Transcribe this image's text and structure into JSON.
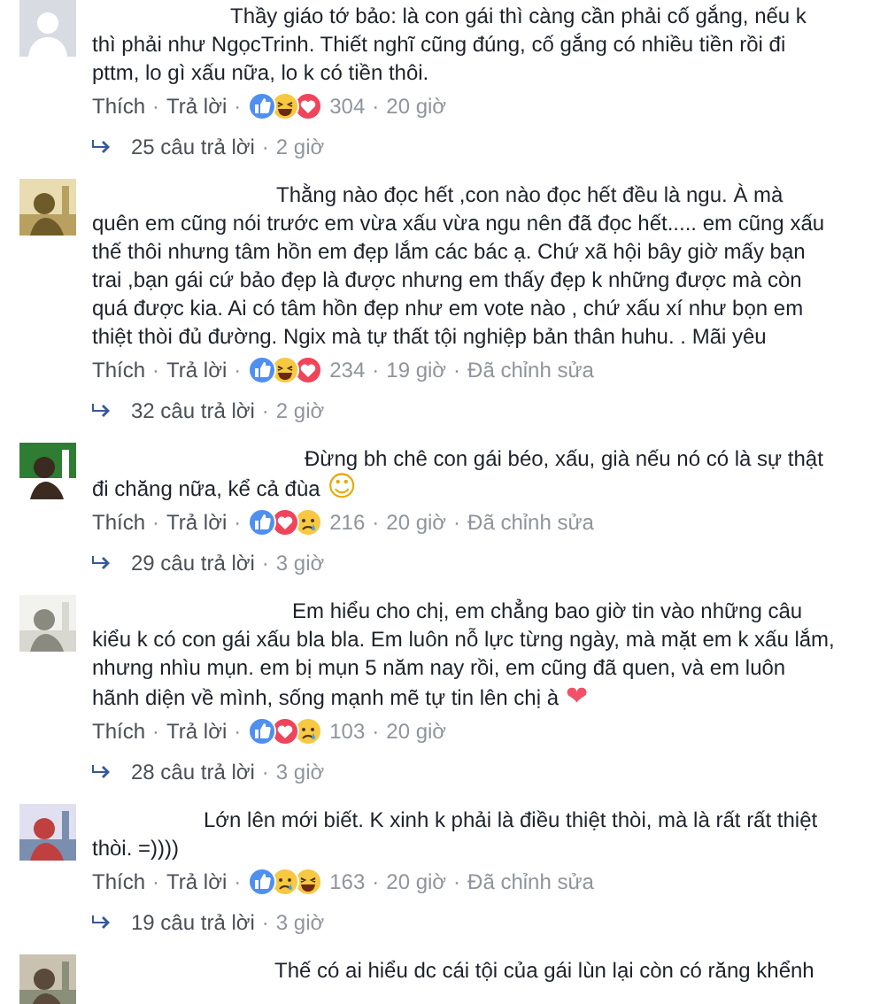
{
  "comments": [
    {
      "avatar": {
        "kind": "default"
      },
      "text": "Thầy giáo tớ bảo: là con gái thì càng cần phải cố gắng, nếu k thì phải như NgọcTrinh. Thiết nghĩ cũng đúng, cố gắng có nhiều tiền rồi đi pttm, lo gì xấu nữa, lo k có tiền thôi.",
      "like": "Thích",
      "reply": "Trả lời",
      "reactions": [
        {
          "kind": "like"
        },
        {
          "kind": "haha"
        },
        {
          "kind": "love"
        }
      ],
      "count": "304",
      "time": "20 giờ",
      "separators": [
        "·",
        "·",
        "·"
      ],
      "replies_separator": "·",
      "replies": "25 câu trả lời",
      "replies_time": "2 giờ"
    },
    {
      "avatar": {
        "kind": "picture"
      },
      "text": "Thằng nào đọc hết ,con nào đọc hết đều là ngu. À mà quên em cũng nói trước em vừa xấu vừa ngu nên đã đọc hết..... em cũng xấu thế thôi nhưng tâm hồn em đẹp lắm các bác ạ. Chứ xã hội bây giờ mấy bạn trai ,bạn gái cứ bảo đẹp là được nhưng em thấy đẹp k những được mà còn quá được kia. Ai có tâm hồn đẹp như em vote nào , chứ xấu xí như bọn em thiệt thòi đủ đường. Ngix mà tự thất tội nghiệp bản thân huhu. . Mãi yêu",
      "like": "Thích",
      "reply": "Trả lời",
      "reactions": [
        {
          "kind": "like"
        },
        {
          "kind": "haha"
        },
        {
          "kind": "love"
        }
      ],
      "count": "234",
      "time": "19 giờ",
      "edited": "Đã chỉnh sửa",
      "separators": [
        "·",
        "·",
        "·",
        "·"
      ],
      "replies_separator": "·",
      "replies": "32 câu trả lời",
      "replies_time": "2 giờ"
    },
    {
      "avatar": {
        "kind": "picture"
      },
      "text": "Đừng bh chê con gái béo, xấu, già nếu nó có là sự thật đi chăng nữa, kể cả đùa",
      "emoji": {
        "kind": "smile",
        "char": "☺"
      },
      "like": "Thích",
      "reply": "Trả lời",
      "reactions": [
        {
          "kind": "like"
        },
        {
          "kind": "love"
        },
        {
          "kind": "sad"
        }
      ],
      "count": "216",
      "time": "20 giờ",
      "edited": "Đã chỉnh sửa",
      "separators": [
        "·",
        "·",
        "·",
        "·"
      ],
      "replies_separator": "·",
      "replies": "29 câu trả lời",
      "replies_time": "3 giờ"
    },
    {
      "avatar": {
        "kind": "picture"
      },
      "text": "Em hiểu cho chị, em chẳng bao giờ tin vào những câu kiểu k có con gái xấu bla bla. Em luôn nỗ lực từng ngày, mà mặt em k xấu lắm, nhưng nhìu mụn. em bị mụn 5 năm nay rồi, em cũng đã quen, và em luôn hãnh diện về mình, sống mạnh mẽ tự tin lên chị à",
      "emoji": {
        "kind": "heart",
        "char": "❤"
      },
      "like": "Thích",
      "reply": "Trả lời",
      "reactions": [
        {
          "kind": "like"
        },
        {
          "kind": "love"
        },
        {
          "kind": "sad"
        }
      ],
      "count": "103",
      "time": "20 giờ",
      "separators": [
        "·",
        "·",
        "·"
      ],
      "replies_separator": "·",
      "replies": "28 câu trả lời",
      "replies_time": "3 giờ"
    },
    {
      "avatar": {
        "kind": "picture"
      },
      "text": "Lớn lên mới biết. K xinh k phải là điều thiệt thòi, mà là rất rất thiệt thòi. =))))",
      "like": "Thích",
      "reply": "Trả lời",
      "reactions": [
        {
          "kind": "like"
        },
        {
          "kind": "sad"
        },
        {
          "kind": "haha"
        }
      ],
      "count": "163",
      "time": "20 giờ",
      "edited": "Đã chỉnh sửa",
      "separators": [
        "·",
        "·",
        "·",
        "·"
      ],
      "replies_separator": "·",
      "replies": "19 câu trả lời",
      "replies_time": "3 giờ"
    },
    {
      "avatar": {
        "kind": "picture"
      },
      "text": "Thế có ai hiểu dc cái tội của gái lùn lại còn có răng khểnh"
    }
  ]
}
